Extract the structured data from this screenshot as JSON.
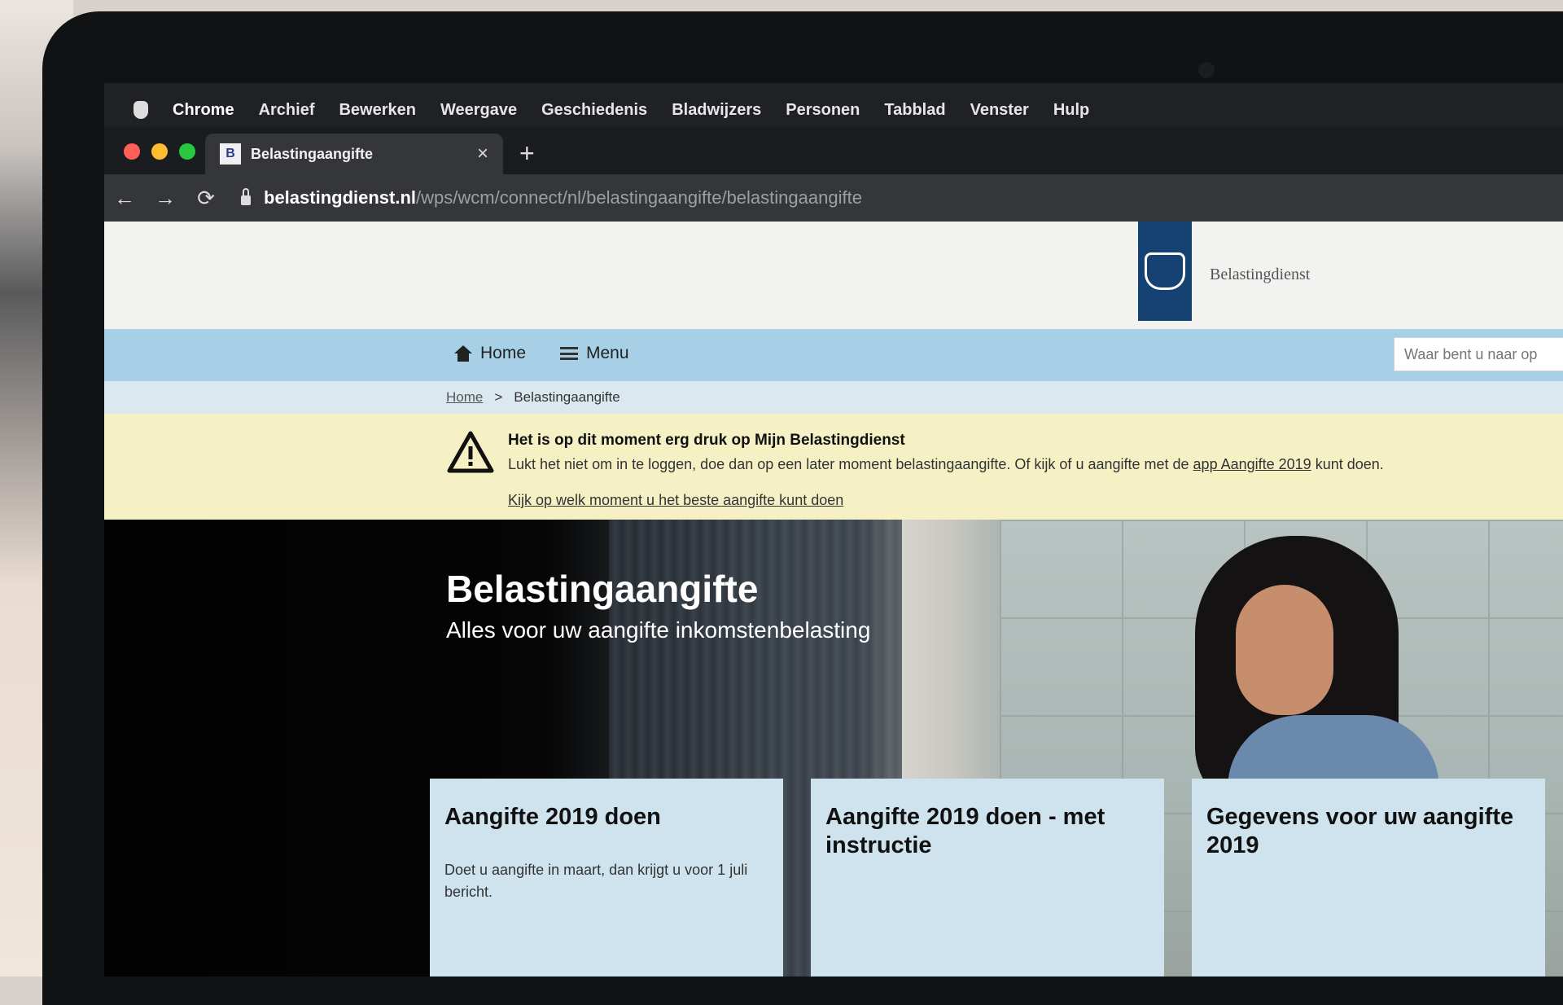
{
  "menubar": {
    "app": "Chrome",
    "items": [
      "Archief",
      "Bewerken",
      "Weergave",
      "Geschiedenis",
      "Bladwijzers",
      "Personen",
      "Tabblad",
      "Venster",
      "Hulp"
    ]
  },
  "tab": {
    "title": "Belastingaangifte",
    "close": "×",
    "new": "+",
    "favicon_glyph": "B"
  },
  "toolbar": {
    "back": "←",
    "forward": "→",
    "reload": "⟳",
    "url_host": "belastingdienst.nl",
    "url_path": "/wps/wcm/connect/nl/belastingaangifte/belastingaangifte"
  },
  "header": {
    "logo_text": "Belastingdienst"
  },
  "nav": {
    "home": "Home",
    "menu": "Menu",
    "search_placeholder": "Waar bent u naar op"
  },
  "breadcrumb": {
    "home": "Home",
    "separator": ">",
    "current": "Belastingaangifte"
  },
  "alert": {
    "title": "Het is op dit moment erg druk op Mijn Belastingdienst",
    "text_before": "Lukt het niet om in te loggen, doe dan op een later moment belastingaangifte. Of kijk of u aangifte met de ",
    "text_link": "app Aangifte 2019",
    "text_after": " kunt doen.",
    "link": "Kijk op welk moment u het beste aangifte kunt doen"
  },
  "hero": {
    "title": "Belastingaangifte",
    "subtitle": "Alles voor uw aangifte inkomstenbelasting"
  },
  "cards": [
    {
      "title": "Aangifte 2019 doen",
      "text": "Doet u aangifte in maart, dan krijgt u voor 1 juli bericht."
    },
    {
      "title": "Aangifte 2019 doen - met instructie",
      "text": ""
    },
    {
      "title": "Gegevens voor uw aangifte 2019",
      "text": ""
    }
  ],
  "colors": {
    "traffic_red": "#ff5f57",
    "traffic_yellow": "#febc2e",
    "traffic_green": "#28c840",
    "brand_blue": "#154273",
    "nav_blue": "#a7cfe6",
    "alert_yellow": "#f5f1c4",
    "card_blue": "#cfe3ee"
  },
  "icons": [
    "apple-icon",
    "favicon-icon",
    "close-icon",
    "plus-icon",
    "back-icon",
    "forward-icon",
    "reload-icon",
    "lock-icon",
    "crest-icon",
    "home-icon",
    "menu-icon",
    "warning-icon"
  ]
}
